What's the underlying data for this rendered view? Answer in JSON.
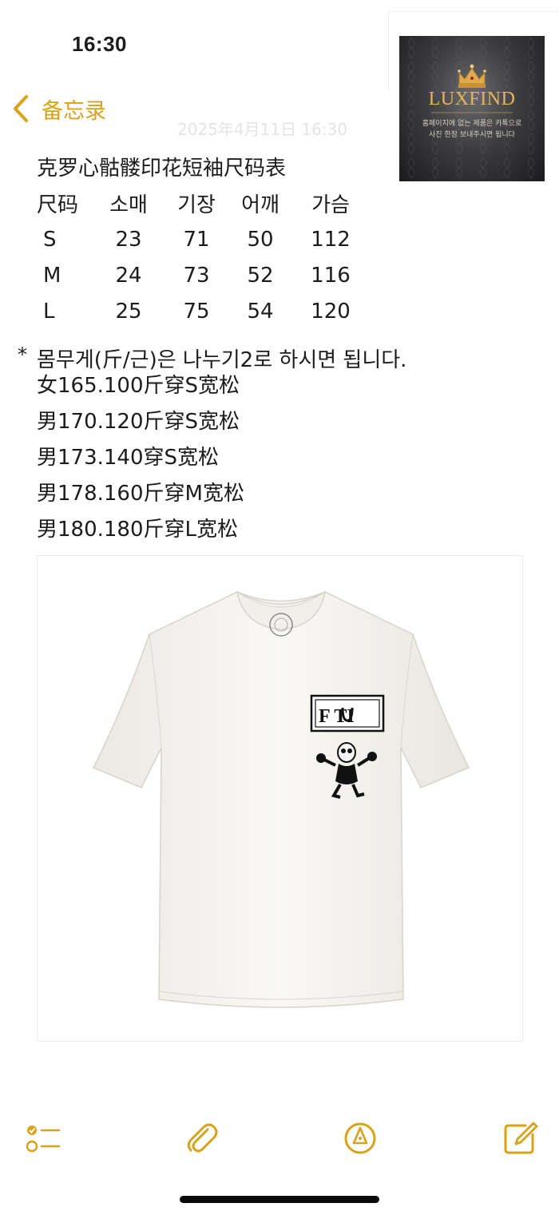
{
  "status_bar": {
    "time": "16:30"
  },
  "nav": {
    "back_label": "备忘录"
  },
  "ghost_text": "2025年4月11日 16:30",
  "brand": {
    "name": "LUXFIND",
    "tagline_1": "홈페이지에 없는 제품은 카톡으로",
    "tagline_2": "사진 한장 보내주시면 됩니다"
  },
  "note": {
    "title": "克罗心骷髅印花短袖尺码表",
    "size_table": {
      "headers": [
        "尺码",
        "소매",
        "기장",
        "어깨",
        "가슴"
      ],
      "rows": [
        [
          "S",
          "23",
          "71",
          "50",
          "112"
        ],
        [
          "M",
          "24",
          "73",
          "52",
          "116"
        ],
        [
          "L",
          "25",
          "75",
          "54",
          "120"
        ]
      ]
    },
    "bullet_mark": "*",
    "bullet_text": "몸무게(斤/근)은 나누기2로 하시면 됩니다.",
    "lines": [
      "女165.100斤穿S宽松",
      "男170.120斤穿S宽松",
      "男173.140穿S宽松",
      "男178.160斤穿M宽松",
      "男180.180斤穿L宽松"
    ]
  },
  "product_image": {
    "print_text": "F TI"
  },
  "toolbar": {
    "checklist_icon": "checklist-icon",
    "attach_icon": "paperclip-icon",
    "markup_icon": "pen-tip-icon",
    "compose_icon": "compose-icon"
  },
  "colors": {
    "accent": "#d9a21b",
    "text": "#1c1c1e",
    "brand_gold": "#e8b45a"
  }
}
